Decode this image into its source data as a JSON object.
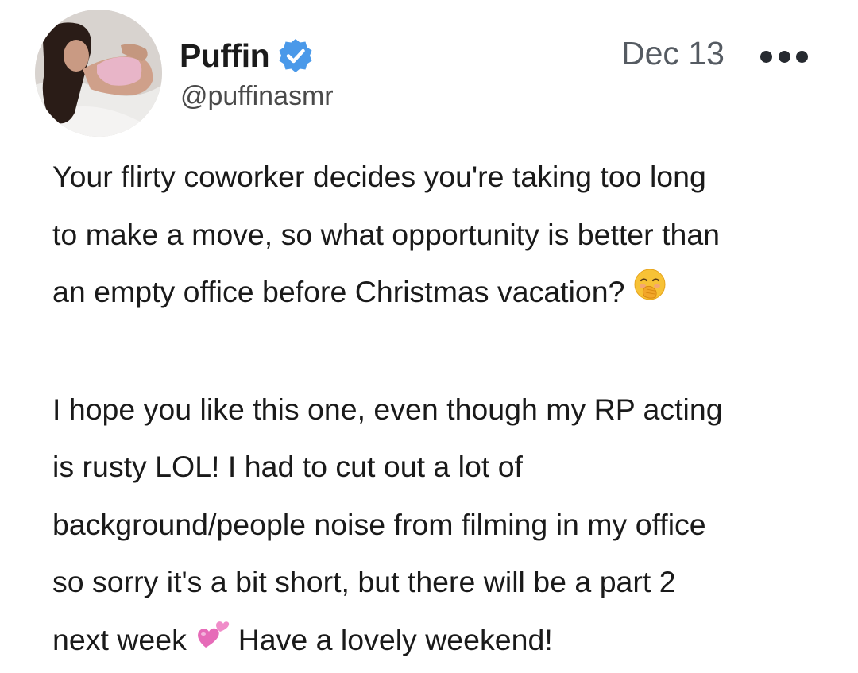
{
  "post": {
    "author": {
      "display_name": "Puffin",
      "handle": "@puffinasmr",
      "verified": true,
      "avatar_icon": "profile-photo"
    },
    "date": "Dec 13",
    "more_icon": "more-horizontal-icon",
    "paragraphs": [
      {
        "lines": [
          "Your flirty coworker decides you're taking too long",
          "to make a move, so what opportunity is better than",
          "an empty office before Christmas vacation?"
        ],
        "trailing_emoji": "face-with-hand-over-mouth"
      },
      {
        "lines": [
          "I hope you like this one, even though my RP acting",
          "is rusty LOL! I had to cut out a lot of",
          "background/people noise from filming in my office",
          "so sorry it's a bit short, but there will be a part 2"
        ],
        "last_line_before_emoji": "next week",
        "inline_emoji": "two-hearts",
        "last_line_after_emoji": "Have a lovely weekend!"
      }
    ]
  },
  "colors": {
    "verified_badge": "#4a99e9",
    "text_primary": "#1a1a1a",
    "text_secondary": "#4a4a4a",
    "date_text": "#555b62"
  }
}
